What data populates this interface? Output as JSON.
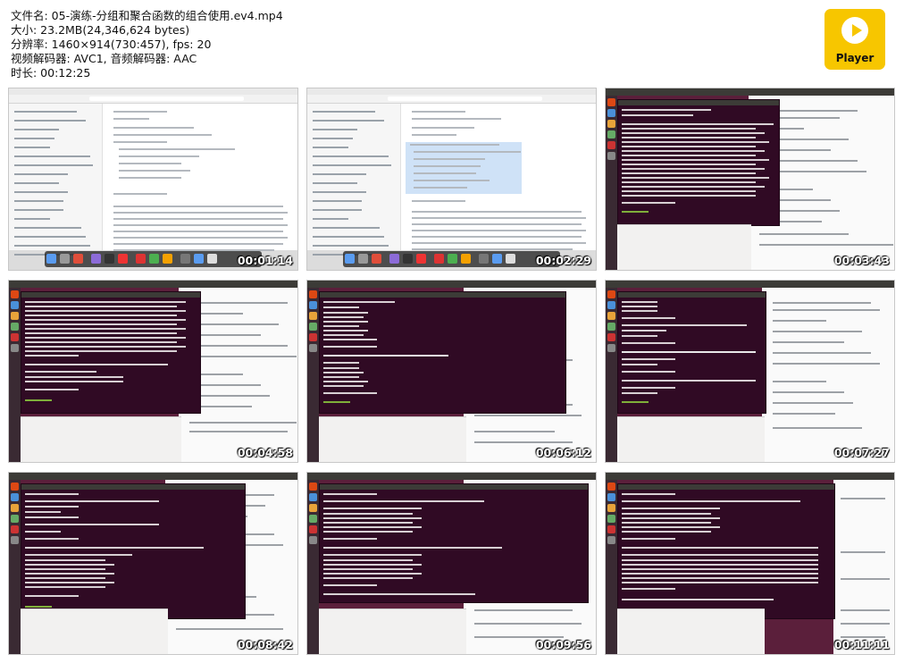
{
  "info": {
    "filename": "文件名: 05-演练-分组和聚合函数的组合使用.ev4.mp4",
    "size": "大小: 23.2MB(24,346,624 bytes)",
    "resolution": "分辨率: 1460×914(730:457), fps: 20",
    "codec": "视频解码器: AVC1, 音频解码器: AAC",
    "duration": "时长: 00:12:25"
  },
  "logo": {
    "label": "Player",
    "color": "#f7c600"
  },
  "thumbnails": [
    {
      "timestamp": "00:01:14",
      "style": "mac"
    },
    {
      "timestamp": "00:02:29",
      "style": "mac"
    },
    {
      "timestamp": "00:03:43",
      "style": "ubuntu"
    },
    {
      "timestamp": "00:04:58",
      "style": "ubuntu"
    },
    {
      "timestamp": "00:06:12",
      "style": "ubuntu"
    },
    {
      "timestamp": "00:07:27",
      "style": "ubuntu"
    },
    {
      "timestamp": "00:08:42",
      "style": "ubuntu"
    },
    {
      "timestamp": "00:09:56",
      "style": "ubuntu"
    },
    {
      "timestamp": "00:11:11",
      "style": "ubuntu"
    }
  ]
}
